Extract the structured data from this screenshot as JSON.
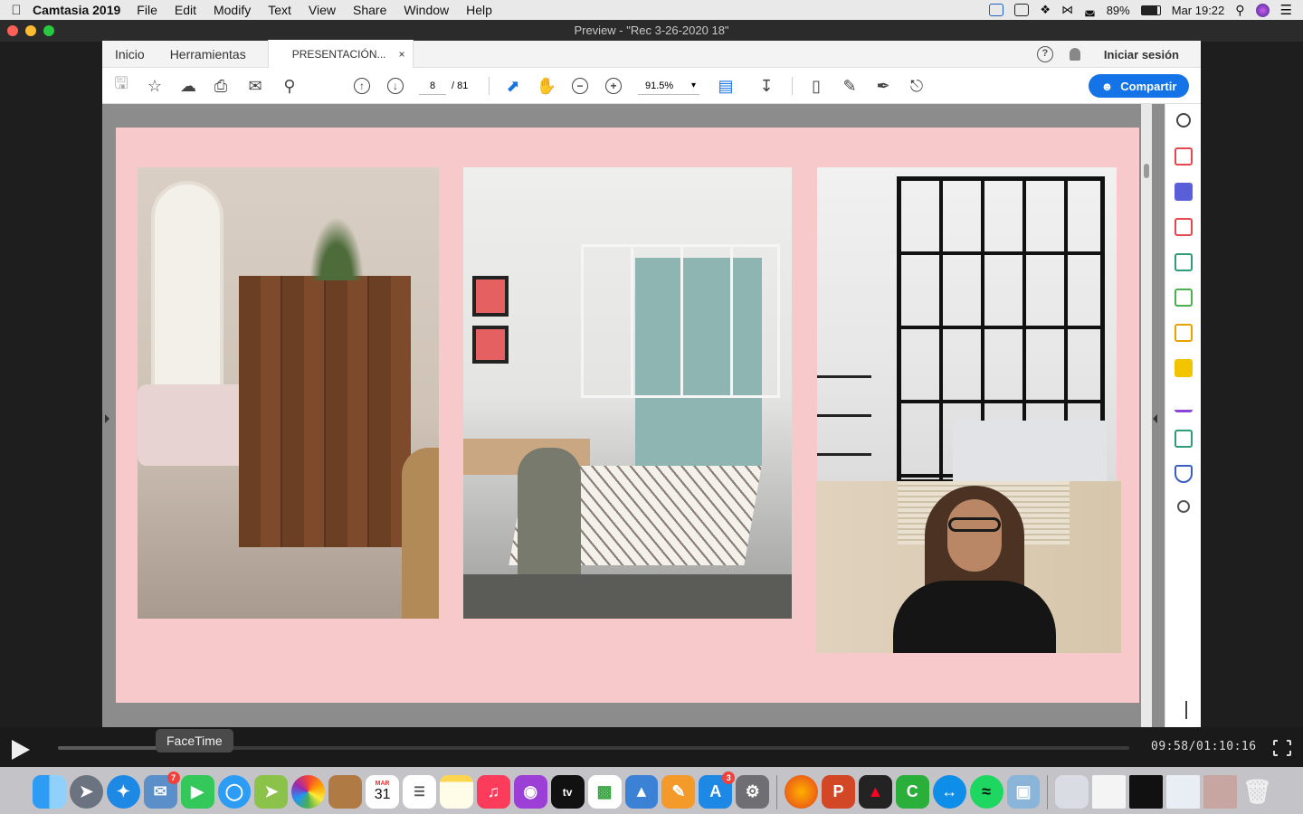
{
  "menubar": {
    "app_name": "Camtasia 2019",
    "items": [
      "File",
      "Edit",
      "Modify",
      "Text",
      "View",
      "Share",
      "Window",
      "Help"
    ],
    "battery": "89%",
    "clock": "Mar 19:22"
  },
  "window": {
    "title": "Preview - \"Rec 3-26-2020 18\""
  },
  "acrobat": {
    "tabs": {
      "home": "Inicio",
      "tools": "Herramientas",
      "document": "PRESENTACIÓN...",
      "close": "×"
    },
    "help": "?",
    "sign_in": "Iniciar sesión",
    "page_current": "8",
    "page_total": "/ 81",
    "zoom": "91.5%",
    "share_label": "Compartir"
  },
  "player": {
    "time": "09:58/01:10:16",
    "progress": 0.098,
    "tooltip": "FaceTime"
  },
  "dock": {
    "calendar_month": "MAR",
    "calendar_day": "31",
    "appletv_label": "tv",
    "messages_badge": "7",
    "appstore_badge": "3"
  },
  "colors": {
    "slide_background": "#f7c9cb",
    "accent": "#1473e6"
  }
}
